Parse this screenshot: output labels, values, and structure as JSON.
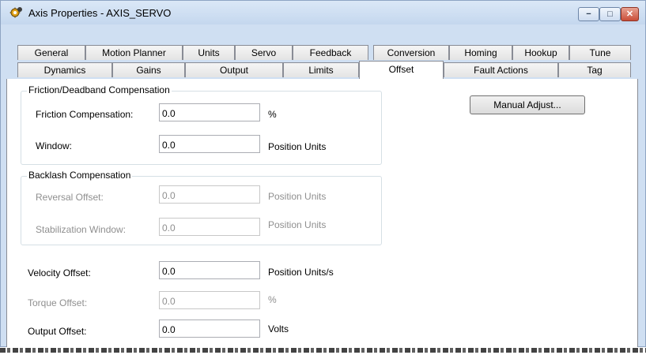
{
  "window": {
    "title": "Axis Properties - AXIS_SERVO"
  },
  "controls": {
    "minimize": "−",
    "maximize": "□",
    "close": "✕"
  },
  "tabs_row1": [
    "General",
    "Motion Planner",
    "Units",
    "Servo",
    "Feedback",
    "Conversion",
    "Homing",
    "Hookup",
    "Tune"
  ],
  "tabs_row2": [
    "Dynamics",
    "Gains",
    "Output",
    "Limits",
    "Offset",
    "Fault Actions",
    "Tag"
  ],
  "active_tab": "Offset",
  "friction": {
    "legend": "Friction/Deadband Compensation",
    "comp_label": "Friction Compensation:",
    "comp_value": "0.0",
    "comp_unit": "%",
    "window_label": "Window:",
    "window_value": "0.0",
    "window_unit": "Position Units"
  },
  "backlash": {
    "legend": "Backlash Compensation",
    "reversal_label": "Reversal Offset:",
    "reversal_value": "0.0",
    "reversal_unit": "Position Units",
    "stab_label": "Stabilization Window:",
    "stab_value": "0.0",
    "stab_unit": "Position Units"
  },
  "velocity": {
    "label": "Velocity Offset:",
    "value": "0.0",
    "unit": "Position Units/s"
  },
  "torque": {
    "label": "Torque Offset:",
    "value": "0.0",
    "unit": "%"
  },
  "output": {
    "label": "Output Offset:",
    "value": "0.0",
    "unit": "Volts"
  },
  "buttons": {
    "manual_adjust": "Manual Adjust..."
  }
}
